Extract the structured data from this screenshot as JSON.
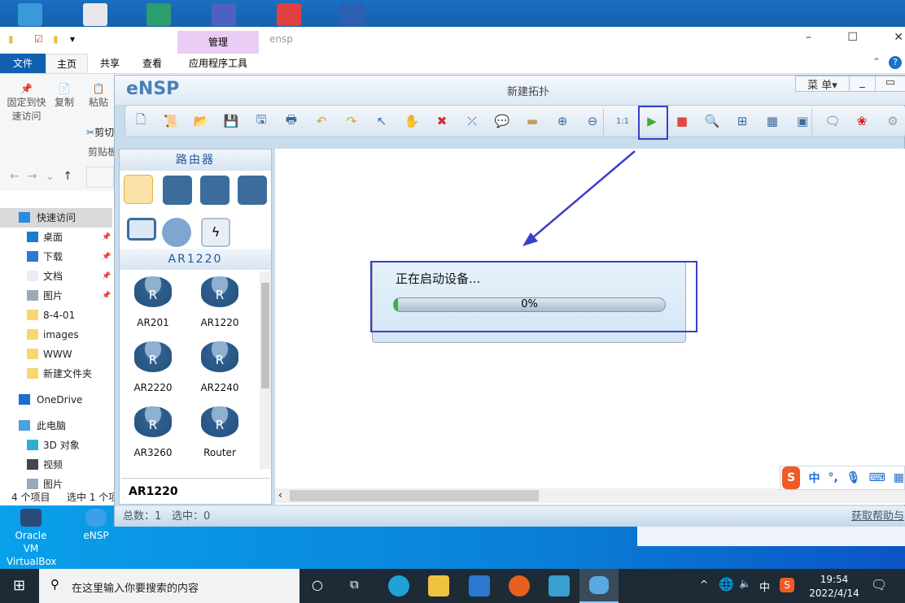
{
  "explorer": {
    "title": "ensp",
    "context_tab": "管理",
    "tabs": [
      "文件",
      "主页",
      "共享",
      "查看",
      "应用程序工具"
    ],
    "ribbon": {
      "pin": "固定到快速访问",
      "copy": "复制",
      "paste": "粘贴",
      "cut": "剪切",
      "clipboard": "剪贴板"
    },
    "nav": [
      {
        "label": "快速访问",
        "icon": "star-icon"
      },
      {
        "label": "桌面",
        "icon": "desktop-icon",
        "pinned": true
      },
      {
        "label": "下载",
        "icon": "download-icon",
        "pinned": true
      },
      {
        "label": "文档",
        "icon": "document-icon",
        "pinned": true
      },
      {
        "label": "图片",
        "icon": "picture-icon",
        "pinned": true
      },
      {
        "label": "8-4-01",
        "icon": "folder-icon"
      },
      {
        "label": "images",
        "icon": "folder-icon"
      },
      {
        "label": "WWW",
        "icon": "folder-icon"
      },
      {
        "label": "新建文件夹",
        "icon": "folder-icon"
      },
      {
        "label": "OneDrive",
        "icon": "cloud-icon"
      },
      {
        "label": "此电脑",
        "icon": "computer-icon"
      },
      {
        "label": "3D 对象",
        "icon": "cube-icon"
      },
      {
        "label": "视频",
        "icon": "video-icon"
      },
      {
        "label": "图片",
        "icon": "picture-icon"
      }
    ],
    "status": {
      "items": "4 个项目",
      "selected": "选中 1 个项"
    }
  },
  "ensp": {
    "logo": "eNSP",
    "title": "新建拓扑",
    "menu": "菜 单▾",
    "toolbar": [
      "new-topology",
      "new-script",
      "open",
      "save",
      "save-as",
      "print",
      "undo",
      "redo",
      "select",
      "pan",
      "delete",
      "delete-link",
      "text-label",
      "rectangle",
      "zoom-in",
      "zoom-out",
      "fit-1-1",
      "start-device",
      "stop-device",
      "capture",
      "topology-view",
      "grid",
      "console",
      "chat",
      "huawei",
      "settings"
    ],
    "category_title": "路由器",
    "categories": [
      "router",
      "switch",
      "wlan",
      "firewall",
      "pc",
      "cloud",
      "link"
    ],
    "selected_group": "AR1220",
    "devices": [
      "AR201",
      "AR1220",
      "AR2220",
      "AR2240",
      "AR3260",
      "Router"
    ],
    "tooltip": "AR1220",
    "dialog": {
      "message": "正在启动设备...",
      "progress_label": "0%",
      "progress": 0
    },
    "status": {
      "total": "总数：1",
      "selected": "选中：0",
      "help": "获取帮助与"
    }
  },
  "desktop": {
    "icons": [
      "Oracle VM VirtualBox",
      "eNSP"
    ]
  },
  "ime": {
    "mode": "中",
    "punct": "°,"
  },
  "taskbar": {
    "search_placeholder": "在这里输入你要搜索的内容",
    "ime": "中",
    "time": "19:54",
    "date": "2022/4/14"
  },
  "colors": {
    "highlight": "#3a3fc8",
    "accent": "#0063b1"
  }
}
